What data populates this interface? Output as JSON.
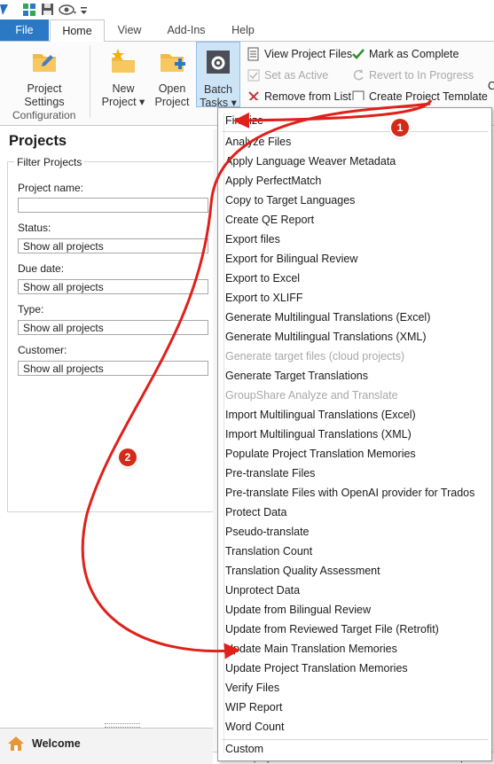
{
  "tabs": {
    "file": "File",
    "home": "Home",
    "view": "View",
    "addins": "Add-Ins",
    "help": "Help"
  },
  "ribbon": {
    "project_settings": [
      "Project",
      "Settings"
    ],
    "new_project": [
      "New",
      "Project ▾"
    ],
    "open_project": [
      "Open",
      "Project"
    ],
    "batch_tasks": [
      "Batch",
      "Tasks ▾"
    ],
    "group_label": "Configuration",
    "view_project_files": "View Project Files",
    "set_as_active": "Set as Active",
    "remove_from_list": "Remove from List",
    "mark_as_complete": "Mark as Complete",
    "revert_to_in_progress": "Revert to In Progress",
    "create_project_template": "Create Project Template",
    "cut_off_label": "C"
  },
  "panel": {
    "title": "Projects",
    "filter_legend": "Filter Projects",
    "fields": [
      {
        "label": "Project name:",
        "value": ""
      },
      {
        "label": "Status:",
        "value": "Show all projects"
      },
      {
        "label": "Due date:",
        "value": "Show all projects"
      },
      {
        "label": "Type:",
        "value": "Show all projects"
      },
      {
        "label": "Customer:",
        "value": "Show all projects"
      }
    ],
    "welcome": "Welcome"
  },
  "menu": {
    "items": [
      {
        "label": "Finalize",
        "disabled": false
      },
      {
        "label": "Analyze Files",
        "disabled": false
      },
      {
        "label": "Apply Language Weaver Metadata",
        "disabled": false
      },
      {
        "label": "Apply PerfectMatch",
        "disabled": false
      },
      {
        "label": "Copy to Target Languages",
        "disabled": false
      },
      {
        "label": "Create QE Report",
        "disabled": false
      },
      {
        "label": "Export files",
        "disabled": false
      },
      {
        "label": "Export for Bilingual Review",
        "disabled": false
      },
      {
        "label": "Export to Excel",
        "disabled": false
      },
      {
        "label": "Export to XLIFF",
        "disabled": false
      },
      {
        "label": "Generate Multilingual Translations (Excel)",
        "disabled": false
      },
      {
        "label": "Generate Multilingual Translations (XML)",
        "disabled": false
      },
      {
        "label": "Generate target files (cloud projects)",
        "disabled": true
      },
      {
        "label": "Generate Target Translations",
        "disabled": false
      },
      {
        "label": "GroupShare Analyze and Translate",
        "disabled": true
      },
      {
        "label": "Import Multilingual Translations (Excel)",
        "disabled": false
      },
      {
        "label": "Import Multilingual Translations (XML)",
        "disabled": false
      },
      {
        "label": "Populate Project Translation Memories",
        "disabled": false
      },
      {
        "label": "Pre-translate Files",
        "disabled": false
      },
      {
        "label": "Pre-translate Files with OpenAI provider for Trados",
        "disabled": false
      },
      {
        "label": "Protect Data",
        "disabled": false
      },
      {
        "label": "Pseudo-translate",
        "disabled": false
      },
      {
        "label": "Translation Count",
        "disabled": false
      },
      {
        "label": "Translation Quality Assessment",
        "disabled": false
      },
      {
        "label": "Unprotect Data",
        "disabled": false
      },
      {
        "label": "Update from Bilingual Review",
        "disabled": false
      },
      {
        "label": "Update from Reviewed Target File (Retrofit)",
        "disabled": false
      },
      {
        "label": "Update Main Translation Memories",
        "disabled": false
      },
      {
        "label": "Update Project Translation Memories",
        "disabled": false
      },
      {
        "label": "Verify Files",
        "disabled": false
      },
      {
        "label": "WIP Report",
        "disabled": false
      },
      {
        "label": "Word Count",
        "disabled": false
      }
    ],
    "custom": "Custom"
  },
  "badges": [
    "1",
    "2"
  ],
  "bottom_bar": [
    "Display",
    "Count",
    "Units",
    "Sequence"
  ],
  "colors": {
    "file_tab": "#2b78c5",
    "arrow": "#e0201a",
    "badge": "#d42a1a"
  }
}
